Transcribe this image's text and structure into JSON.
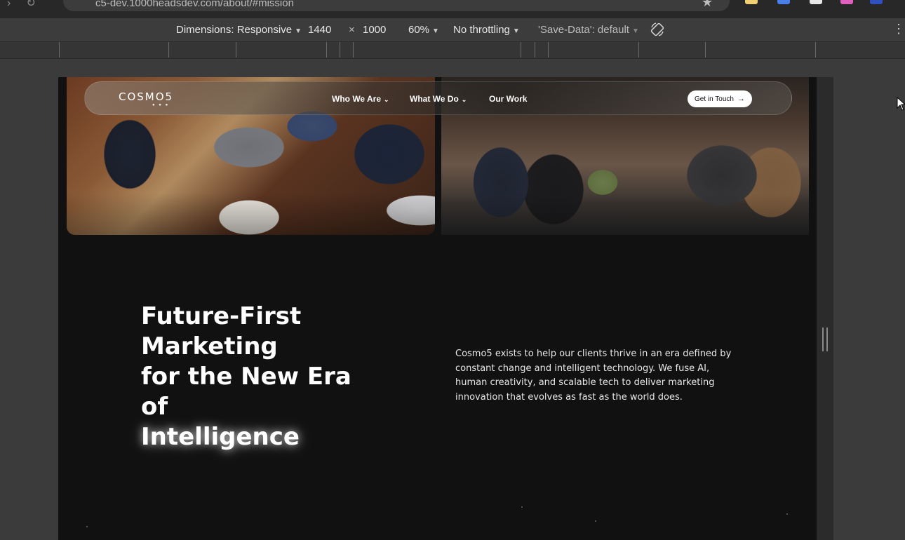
{
  "browser": {
    "url": "c5-dev.1000headsdev.com/about/#mission"
  },
  "device_toolbar": {
    "dimensions_label": "Dimensions: Responsive",
    "width": "1440",
    "times": "×",
    "height": "1000",
    "zoom": "60%",
    "throttling": "No throttling",
    "save_data": "'Save-Data': default"
  },
  "site": {
    "logo": "COSMO5",
    "nav": {
      "who_we_are": "Who We Are",
      "what_we_do": "What We Do",
      "our_work": "Our Work",
      "cta": "Get in Touch"
    },
    "hero": {
      "headline_lines": [
        "Future-First",
        "Marketing",
        "for the New Era",
        "of"
      ],
      "headline_strong": "Intelligence",
      "body": "Cosmo5 exists to help our clients thrive in an era defined by constant change and intelligent technology. We fuse AI, human creativity, and scalable tech to deliver marketing innovation that evolves as fast as the world does."
    }
  },
  "colors": {
    "page_bg": "#111111",
    "devtools_bg": "#3c3c3c",
    "text": "#ffffff"
  }
}
